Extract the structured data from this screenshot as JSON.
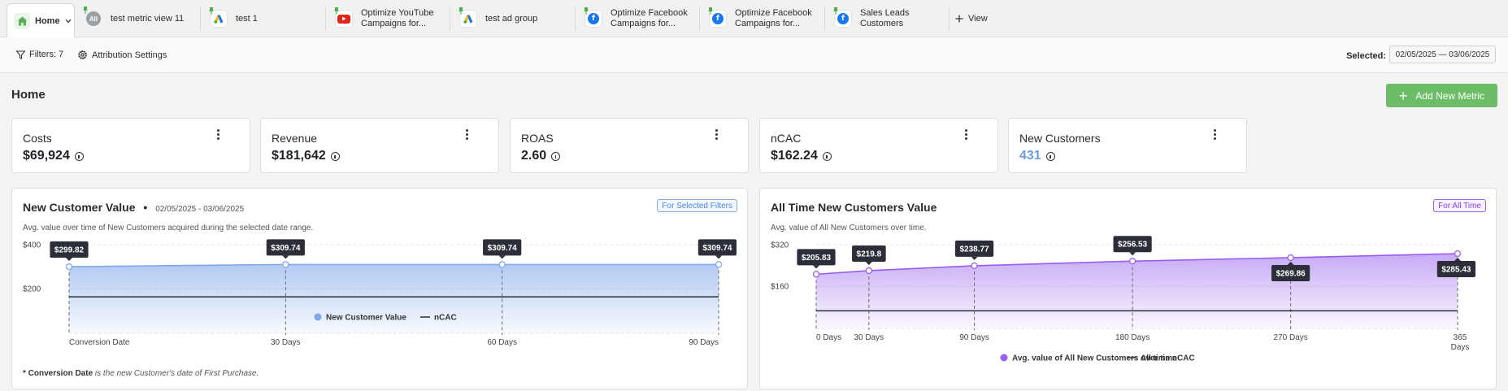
{
  "tabs": [
    {
      "label": "Home",
      "icon": "home-icon",
      "active": true
    },
    {
      "label": "test metric view 11",
      "icon": "all-avatar-icon",
      "badge": "All"
    },
    {
      "label": "test 1",
      "icon": "google-ads-icon"
    },
    {
      "label_line1": "Optimize YouTube",
      "label_line2": "Campaigns for...",
      "icon": "youtube-icon"
    },
    {
      "label": "test ad group",
      "icon": "google-ads-icon"
    },
    {
      "label_line1": "Optimize Facebook",
      "label_line2": "Campaigns for...",
      "icon": "facebook-icon"
    },
    {
      "label_line1": "Optimize Facebook",
      "label_line2": "Campaigns for...",
      "icon": "facebook-icon"
    },
    {
      "label_line1": "Sales Leads",
      "label_line2": "Customers",
      "icon": "facebook-icon"
    }
  ],
  "add_view_label": "View",
  "filters": {
    "label": "Filters: 7",
    "attribution_label": "Attribution Settings"
  },
  "selected": {
    "label": "Selected:",
    "date_range": "02/05/2025 — 03/06/2025"
  },
  "page": {
    "title": "Home",
    "add_metric_label": "Add New Metric"
  },
  "kpis": [
    {
      "label": "Costs",
      "value": "$69,924"
    },
    {
      "label": "Revenue",
      "value": "$181,642"
    },
    {
      "label": "ROAS",
      "value": "2.60"
    },
    {
      "label": "nCAC",
      "value": "$162.24"
    },
    {
      "label": "New Customers",
      "value": "431",
      "accent": "#6d9ae3"
    }
  ],
  "colors": {
    "blue": "#7ea6ea",
    "purple": "#9b5cf0",
    "green": "#6dbd68",
    "ncac_line": "#3a3a44"
  },
  "chart_data": [
    {
      "type": "area",
      "title": "New Customer Value",
      "date_range": "02/05/2025 - 03/06/2025",
      "subtitle": "Avg. value over time of New Customers acquired during the selected date range.",
      "pill": "For Selected Filters",
      "y_ticks": [
        "$400",
        "$200"
      ],
      "ylim": [
        0,
        420
      ],
      "x": [
        "Conversion Date",
        "30 Days",
        "60 Days",
        "90 Days"
      ],
      "series": [
        {
          "name": "New Customer Value",
          "values": [
            299.82,
            309.74,
            309.74,
            309.74
          ],
          "labels": [
            "$299.82",
            "$309.74",
            "$309.74",
            "$309.74"
          ]
        },
        {
          "name": "nCAC",
          "values": [
            162.24,
            162.24,
            162.24,
            162.24
          ]
        }
      ],
      "footnote_bold": "* Conversion Date",
      "footnote_rest": "is the new Customer's date of First Purchase."
    },
    {
      "type": "area",
      "title": "All Time New Customers Value",
      "subtitle": "Avg. value of All New Customers over time.",
      "pill": "For All Time",
      "y_ticks": [
        "$320",
        "$160"
      ],
      "ylim": [
        0,
        340
      ],
      "x_numeric": [
        0,
        30,
        90,
        180,
        270,
        365
      ],
      "x": [
        "0 Days",
        "30 Days",
        "90 Days",
        "180 Days",
        "270 Days",
        "365 Days"
      ],
      "series": [
        {
          "name": "Avg. value of All New Customers over time",
          "values": [
            205.83,
            219.8,
            238.77,
            256.53,
            269.86,
            285.43
          ],
          "labels": [
            "$205.83",
            "$219.8",
            "$238.77",
            "$256.53",
            "$269.86",
            "$285.43"
          ]
        },
        {
          "name": "All time nCAC",
          "values": [
            65,
            65,
            65,
            65,
            65,
            65
          ]
        }
      ]
    }
  ]
}
